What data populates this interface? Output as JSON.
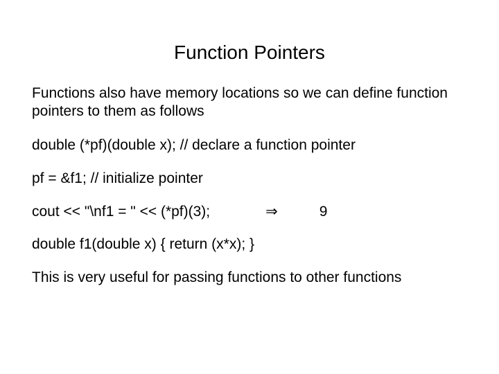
{
  "title": "Function Pointers",
  "intro": "Functions also have memory locations so we can define function pointers to them as follows",
  "decl": "double (*pf)(double x);  // declare a function pointer",
  "init": "pf = &f1; // initialize pointer",
  "cout_line": "cout << \"\\nf1 = \" << (*pf)(3);",
  "arrow": "⇒",
  "result": "9",
  "fdef": "double f1(double x) { return (x*x); }",
  "note": "This is very useful for passing functions to other functions"
}
